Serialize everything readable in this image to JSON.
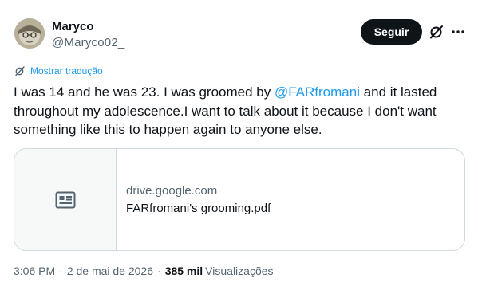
{
  "author": {
    "name": "Maryco",
    "handle": "@Maryco02_",
    "avatar_icon": "avatar"
  },
  "actions": {
    "follow_label": "Seguir",
    "grok_icon": "grok-icon",
    "more_icon": "more-icon"
  },
  "translate": {
    "label": "Mostrar tradução",
    "icon": "translate-icon"
  },
  "tweet": {
    "text_before": "I was 14 and he was 23. I was groomed by ",
    "mention": "@FARfromani",
    "text_after": " and it lasted throughout my adolescence.I want to talk about it because I don't want something like this to happen again to anyone else."
  },
  "card": {
    "domain": "drive.google.com",
    "title": "FARfromani's grooming.pdf",
    "icon": "document-icon"
  },
  "meta": {
    "time": "3:06 PM",
    "separator": "·",
    "date": "2 de mai de 2026",
    "views_count": "385 mil",
    "views_label": "Visualizações"
  },
  "colors": {
    "accent": "#1d9bf0",
    "text": "#0f1419",
    "secondary": "#536471",
    "border": "#cfd9de",
    "button_bg": "#0f1419"
  }
}
